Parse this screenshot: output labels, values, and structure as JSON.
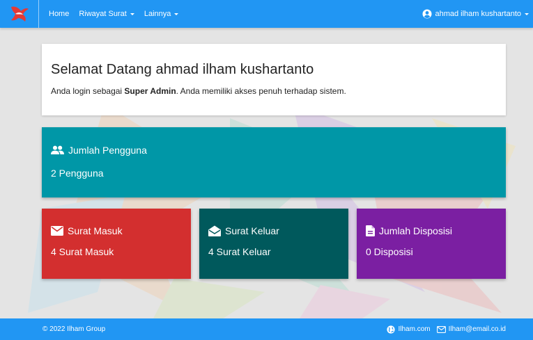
{
  "navbar": {
    "logo_icon": "abstract-bird-logo",
    "items": [
      {
        "label": "Home",
        "has_dropdown": false
      },
      {
        "label": "Riwayat Surat",
        "has_dropdown": true
      },
      {
        "label": "Lainnya",
        "has_dropdown": true
      }
    ],
    "user_name": "ahmad ilham kushartanto",
    "user_icon": "user-circle-icon"
  },
  "welcome": {
    "heading": "Selamat Datang ahmad ilham kushartanto",
    "text_before": "Anda login sebagai ",
    "role": "Super Admin",
    "text_after": ". Anda memiliki akses penuh terhadap sistem."
  },
  "cards": {
    "users": {
      "title": "Jumlah Pengguna",
      "value": "2 Pengguna",
      "icon": "users-icon",
      "color": "#0097a7"
    },
    "incoming": {
      "title": "Surat Masuk",
      "value": "4 Surat Masuk",
      "icon": "envelope-icon",
      "color": "#d32f2f"
    },
    "outgoing": {
      "title": "Surat Keluar",
      "value": "4 Surat Keluar",
      "icon": "envelope-open-icon",
      "color": "#00595c"
    },
    "disposition": {
      "title": "Jumlah Disposisi",
      "value": "0 Disposisi",
      "icon": "file-icon",
      "color": "#7b1fa2"
    }
  },
  "footer": {
    "copyright": "© 2022 Ilham Group",
    "website": "Ilham.com",
    "email": "Ilham@email.co.id"
  },
  "colors": {
    "primary": "#2196f3",
    "background": "#e4e4e4"
  }
}
